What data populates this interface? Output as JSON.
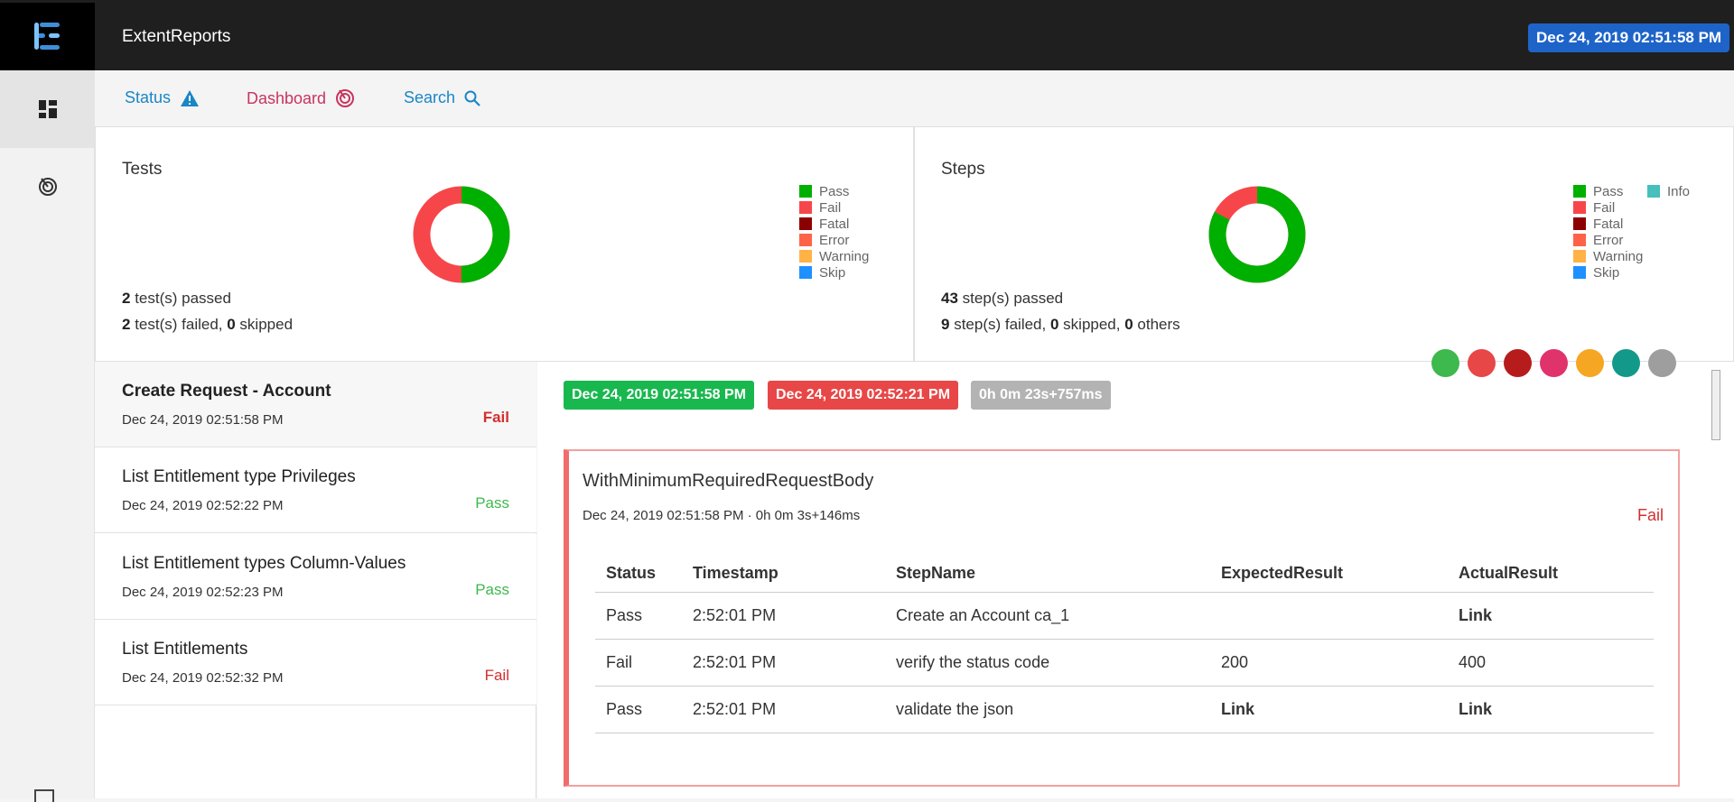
{
  "app": {
    "title": "ExtentReports",
    "date": "Dec 24, 2019 02:51:58 PM"
  },
  "colors": {
    "pass": "#00b000",
    "fail": "#f7464a",
    "fatal": "#8b0000",
    "error": "#ff6347",
    "warning": "#ffb347",
    "skip": "#1e90ff",
    "info": "#46bfbd"
  },
  "subnav": {
    "status": "Status",
    "dashboard": "Dashboard",
    "search": "Search"
  },
  "tests_panel": {
    "title": "Tests",
    "legend": [
      "Pass",
      "Fail",
      "Fatal",
      "Error",
      "Warning",
      "Skip"
    ],
    "summary_line1_count": "2",
    "summary_line1_text": " test(s) passed",
    "summary_line2_count": "2",
    "summary_line2_text": " test(s) failed, ",
    "summary_line2_skip": "0",
    "summary_line2_skip_text": " skipped",
    "donut": {
      "pass": 2,
      "fail": 2
    }
  },
  "steps_panel": {
    "title": "Steps",
    "legend": [
      "Pass",
      "Fail",
      "Fatal",
      "Error",
      "Warning",
      "Skip"
    ],
    "legend_extra": "Info",
    "summary_line1_count": "43",
    "summary_line1_text": " step(s) passed",
    "summary_line2_count": "9",
    "summary_line2_text": " step(s) failed, ",
    "summary_line2_skip": "0",
    "summary_line2_skip_text": " skipped, ",
    "summary_line2_others": "0",
    "summary_line2_others_text": " others",
    "donut": {
      "pass": 43,
      "fail": 9
    }
  },
  "tests": [
    {
      "name": "Create Request - Account",
      "date": "Dec 24, 2019 02:51:58 PM",
      "status": "Fail"
    },
    {
      "name": "List Entitlement type Privileges",
      "date": "Dec 24, 2019 02:52:22 PM",
      "status": "Pass"
    },
    {
      "name": "List Entitlement types Column-Values",
      "date": "Dec 24, 2019 02:52:23 PM",
      "status": "Pass"
    },
    {
      "name": "List Entitlements",
      "date": "Dec 24, 2019 02:52:32 PM",
      "status": "Fail"
    }
  ],
  "detail": {
    "start": "Dec 24, 2019 02:51:58 PM",
    "end": "Dec 24, 2019 02:52:21 PM",
    "duration": "0h 0m 23s+757ms",
    "node": {
      "title": "WithMinimumRequiredRequestBody",
      "meta": "Dec 24, 2019 02:51:58 PM · 0h 0m 3s+146ms",
      "status": "Fail",
      "columns": [
        "Status",
        "Timestamp",
        "StepName",
        "ExpectedResult",
        "ActualResult"
      ],
      "rows": [
        [
          "Pass",
          "2:52:01 PM",
          "Create an Account ca_1",
          "",
          "Link"
        ],
        [
          "Fail",
          "2:52:01 PM",
          "verify the status code",
          "200",
          "400"
        ],
        [
          "Pass",
          "2:52:01 PM",
          "validate the json",
          "Link",
          "Link"
        ]
      ]
    }
  }
}
